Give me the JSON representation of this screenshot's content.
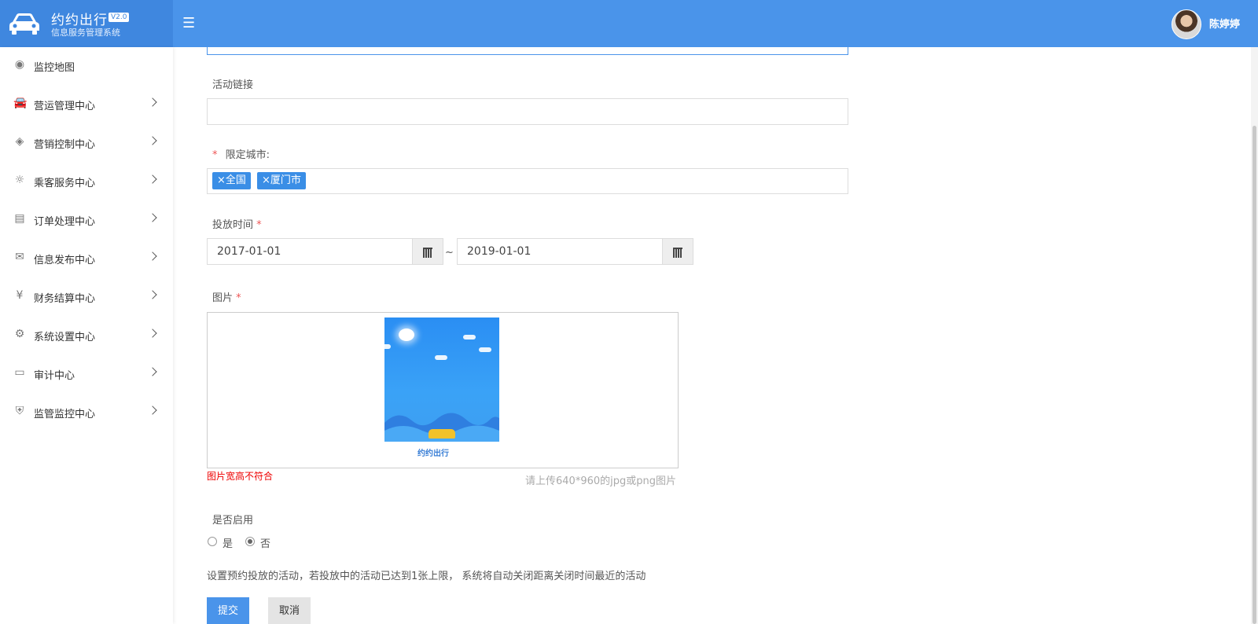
{
  "header": {
    "brand_title": "约约出行",
    "brand_version": "V2.0",
    "brand_subtitle": "信息服务管理系统",
    "menu_toggle": "☰",
    "user_name": "陈婷婷"
  },
  "sidebar": {
    "items": [
      {
        "label": "监控地图",
        "icon": "map-pin-icon",
        "glyph": "◉"
      },
      {
        "label": "营运管理中心",
        "icon": "car-icon",
        "glyph": "🚘"
      },
      {
        "label": "营销控制中心",
        "icon": "tag-icon",
        "glyph": "◈"
      },
      {
        "label": "乘客服务中心",
        "icon": "lightbulb-icon",
        "glyph": "☼"
      },
      {
        "label": "订单处理中心",
        "icon": "document-icon",
        "glyph": "▤"
      },
      {
        "label": "信息发布中心",
        "icon": "envelope-icon",
        "glyph": "✉"
      },
      {
        "label": "财务结算中心",
        "icon": "yen-icon",
        "glyph": "¥"
      },
      {
        "label": "系统设置中心",
        "icon": "gear-icon",
        "glyph": "⚙"
      },
      {
        "label": "审计中心",
        "icon": "monitor-icon",
        "glyph": "▭"
      },
      {
        "label": "监管监控中心",
        "icon": "shield-icon",
        "glyph": "⛨"
      }
    ]
  },
  "form": {
    "activity_link_label": "活动链接",
    "activity_link_value": "",
    "city_label": "限定城市:",
    "required_mark": "*",
    "city_tags": [
      "×全国",
      "×厦门市"
    ],
    "time_label": "投放时间",
    "start_date": "2017-01-01",
    "end_date": "2019-01-01",
    "date_separator": "~",
    "image_label": "图片",
    "preview_logo_text": "约约出行",
    "image_error": "图片宽高不符合",
    "image_hint": "请上传640*960的jpg或png图片",
    "enable_label": "是否启用",
    "enable_yes": "是",
    "enable_no": "否",
    "enabled": false,
    "note": "设置预约投放的活动，若投放中的活动已达到1张上限， 系统将自动关闭距离关闭时间最近的活动",
    "submit_label": "提交",
    "cancel_label": "取消"
  },
  "colors": {
    "header_bg": "#4a94ea",
    "brand_bg": "#3f87df",
    "tag_bg": "#3a8ee6",
    "error": "#e00000",
    "required": "#e55555"
  }
}
